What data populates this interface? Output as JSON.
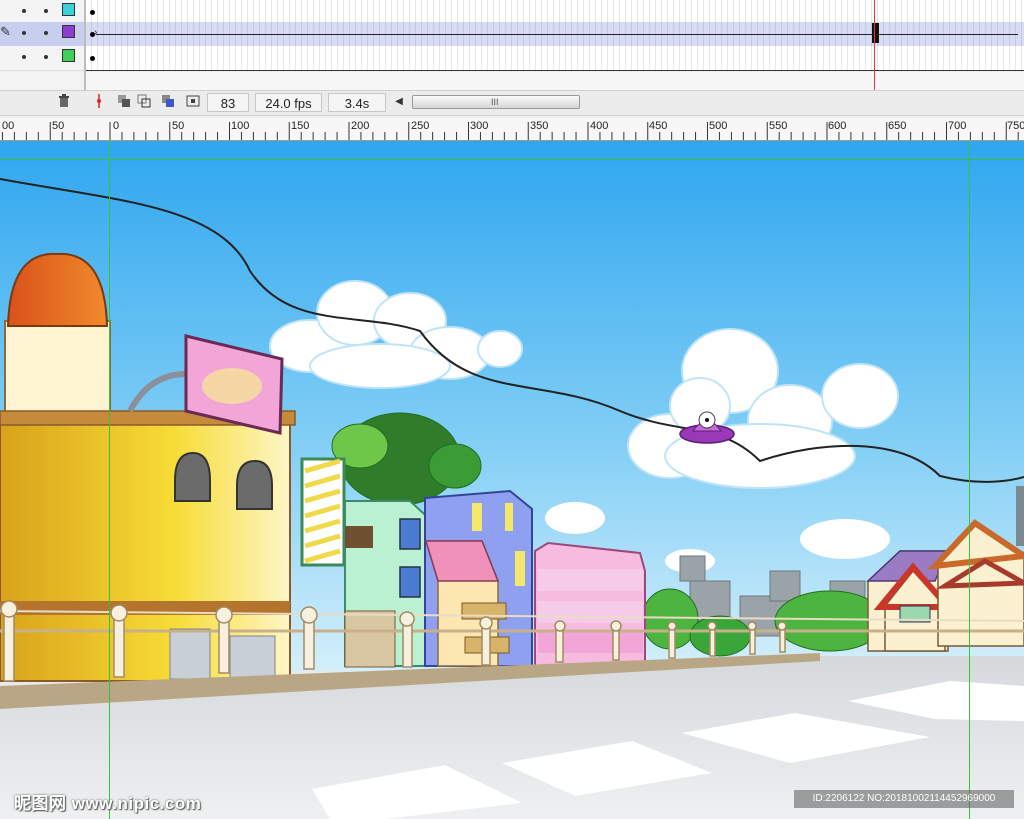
{
  "timeline": {
    "layers": [
      {
        "color": "#39d2d8",
        "selected": false,
        "has_tween": false
      },
      {
        "color": "#8a3fd0",
        "selected": true,
        "has_tween": true
      },
      {
        "color": "#3fd05a",
        "selected": false,
        "has_tween": false
      }
    ]
  },
  "status_bar": {
    "current_frame": "83",
    "frame_rate": "24.0 fps",
    "elapsed_time": "3.4s",
    "scroll_grip": "III",
    "scroll_left_arrow": "◀",
    "icons": [
      "trash-icon",
      "center-frame-icon",
      "onion-skin-icon",
      "onion-skin-outlines-icon",
      "edit-multiple-frames-icon",
      "modify-onion-markers-icon"
    ]
  },
  "ruler": {
    "labels": [
      "00",
      "50",
      "0",
      "50",
      "100",
      "150",
      "200",
      "250",
      "300",
      "350",
      "400",
      "450",
      "500",
      "550",
      "600",
      "650",
      "700",
      "750"
    ]
  },
  "stage": {
    "colors": {
      "sky_top": "#2fa6ef",
      "sky_bottom": "#c9ebfb",
      "road": "#e4e6e8",
      "guide": "#38c238"
    }
  },
  "watermark": {
    "site": "昵图网 www.nipic.com",
    "id_text": "ID:2206122 NO:20181002114452969000"
  }
}
